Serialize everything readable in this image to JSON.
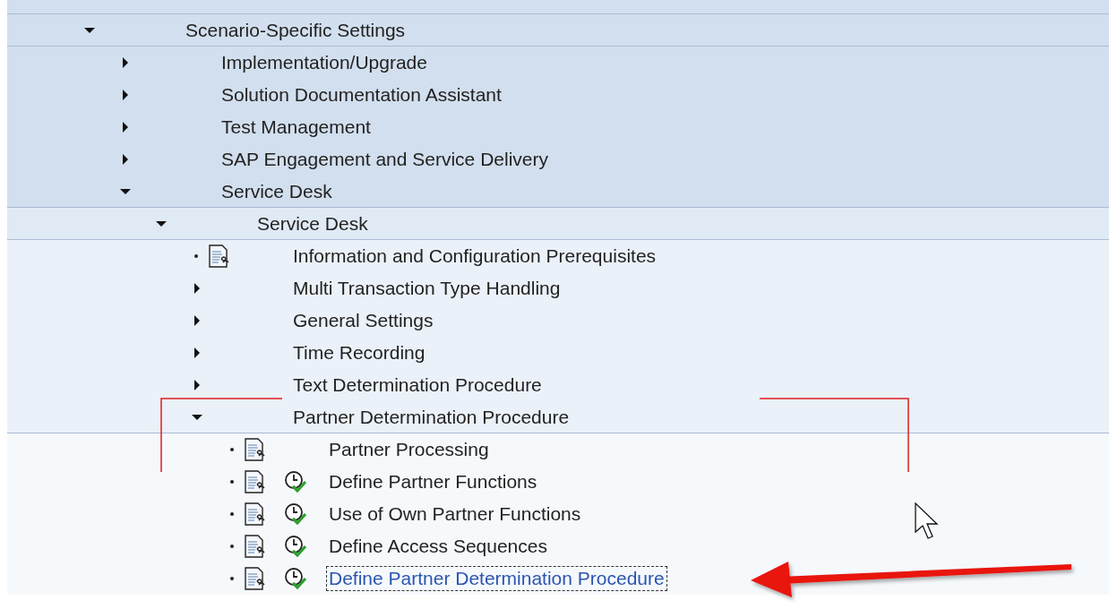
{
  "tree": [
    {
      "label": "Scenario-Specific Settings",
      "kind": "folder",
      "expanded": true,
      "selected": false,
      "children": [
        {
          "label": "Implementation/Upgrade",
          "kind": "folder",
          "expanded": false,
          "selected": false
        },
        {
          "label": "Solution Documentation Assistant",
          "kind": "folder",
          "expanded": false,
          "selected": false
        },
        {
          "label": "Test Management",
          "kind": "folder",
          "expanded": false,
          "selected": false
        },
        {
          "label": "SAP Engagement and Service Delivery",
          "kind": "folder",
          "expanded": false,
          "selected": false
        },
        {
          "label": "Service Desk",
          "kind": "folder",
          "expanded": true,
          "selected": false,
          "children": [
            {
              "label": "Service Desk",
              "kind": "folder",
              "expanded": true,
              "selected": false,
              "children": [
                {
                  "label": "Information and Configuration Prerequisites",
                  "kind": "doc",
                  "selected": false
                },
                {
                  "label": "Multi Transaction Type Handling",
                  "kind": "folder",
                  "expanded": false,
                  "selected": false
                },
                {
                  "label": "General Settings",
                  "kind": "folder",
                  "expanded": false,
                  "selected": false
                },
                {
                  "label": "Time Recording",
                  "kind": "folder",
                  "expanded": false,
                  "selected": false
                },
                {
                  "label": "Text Determination Procedure",
                  "kind": "folder",
                  "expanded": false,
                  "selected": false
                },
                {
                  "label": "Partner Determination Procedure",
                  "kind": "folder",
                  "expanded": true,
                  "selected": false,
                  "children": [
                    {
                      "label": "Partner Processing",
                      "kind": "doc",
                      "selected": false
                    },
                    {
                      "label": "Define Partner Functions",
                      "kind": "activity",
                      "selected": false
                    },
                    {
                      "label": "Use of Own Partner Functions",
                      "kind": "activity",
                      "selected": false
                    },
                    {
                      "label": "Define Access Sequences",
                      "kind": "activity",
                      "selected": false
                    },
                    {
                      "label": "Define Partner Determination Procedure",
                      "kind": "activity",
                      "selected": true
                    }
                  ]
                }
              ]
            }
          ]
        }
      ]
    }
  ]
}
